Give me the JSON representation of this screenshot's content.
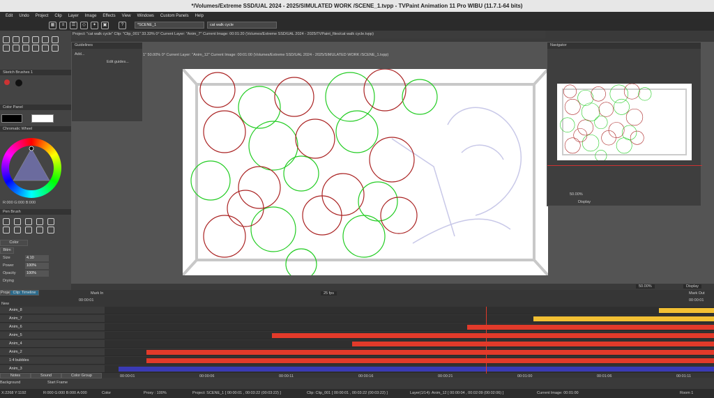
{
  "window": {
    "title": "*/Volumes/Extreme SSD/UAL 2024 - 2025/SIMULATED WORK /SCENE_1.tvpp - TVPaint Animation 11 Pro WIBU (11.7.1-64 bits)"
  },
  "menu": [
    "Edit",
    "Undo",
    "Project",
    "Clip",
    "Layer",
    "Image",
    "Effects",
    "View",
    "Windows",
    "Custom Panels",
    "Help"
  ],
  "toolbar": {
    "scene_value": "*SCENE_1",
    "clip_value": "cat walk cycle"
  },
  "info_main": "Project: \"cat walk cycle\"  Clip: \"Clip_001\"  33.33%  0°  Current Layer: \"Anim_7\"  Current Image: 00:01:20  (Volumes/Extreme SSD/UAL 2024 - 2025/TVPaint_files/cat walk cycle.tvpp)",
  "info_second": "1\"  50.00%  0°  Current Layer: \"Anim_12\"  Current Image: 00:01:00  (Volumes/Extreme SSD/UAL 2024 - 2025/SIMULATED WORK /SCENE_1.tvpp)",
  "guidelines": {
    "title": "Guidelines",
    "add": "Add...",
    "edit": "Edit guides..."
  },
  "left": {
    "sketch_title": "Sketch Brushes 1",
    "color_panel": "Color Panel",
    "wheel_title": "Chromatic Wheel",
    "rgb": "R:000 G:000 B:000",
    "pen_title": "Pen Brush",
    "color_tab": "Color",
    "tools_tab": "Bttm",
    "size_label": "Size",
    "size_val": "4.10",
    "power_label": "Power",
    "power_val": "100%",
    "opacity_label": "Opacity",
    "opacity_val": "100%",
    "drying_label": "Drying"
  },
  "navigator": {
    "title": "Navigator",
    "zoom": "50.00%",
    "display": "Display"
  },
  "canvas_foot": {
    "zoom": "50.00%",
    "display": "Display"
  },
  "timeline": {
    "tab_project": "Project",
    "tab_clip": "Clip: Timeline",
    "mark_in": "Mark In",
    "mark_out": "Mark Out",
    "fps": "25 fps",
    "start_tc": "00:00:01",
    "end_tc": "00:00:01",
    "new": "New",
    "layers": [
      "Anim_8",
      "Anim_7",
      "Anim_6",
      "Anim_5",
      "Anim_4",
      "Anim_2",
      "1:4 bubbles",
      "Anim_3"
    ],
    "ruler": [
      "00:00:01",
      "00:00:06",
      "00:00:11",
      "00:00:16",
      "00:00:21",
      "00:01:00",
      "00:01:06",
      "00:01:11"
    ],
    "footer": {
      "notes": "Notes",
      "sound": "Sound",
      "color_group": "Color Group",
      "background": "Background",
      "start_frame": "Start Frame"
    },
    "colors": {
      "red": "#e23a2a",
      "yellow": "#f2c033",
      "blue": "#3a3ab5"
    }
  },
  "status": {
    "coords": "X:2268  Y:1192",
    "rgba": "R:000 G:000 B:000 A:000",
    "color": "Color",
    "proxy": "Proxy : 100%",
    "project": "Project: SCENE_1 [ 00:00:01 , 00:03:22 (00:03:22) ]",
    "clip": "Clip: Clip_001 [ 00:00:01 , 00:03:22 (00:03:22) ]",
    "layer": "Layer(1/14): Anim_12 [ 00:00:04 , 00:02:09 (00:02:06) ]",
    "image": "Current Image: 00:01:00",
    "room": "Room 1"
  }
}
